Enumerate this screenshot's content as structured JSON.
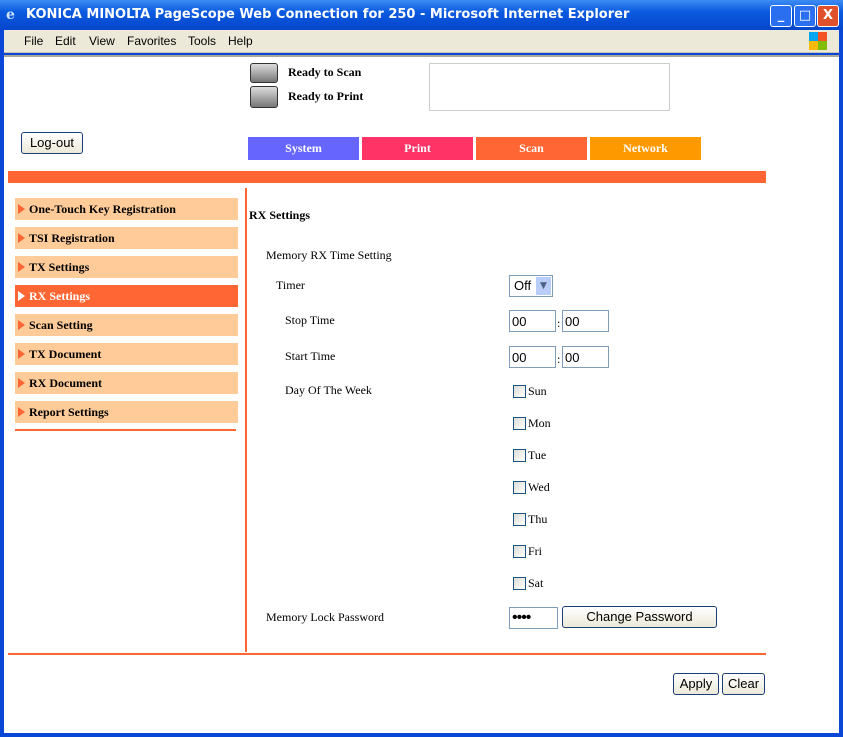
{
  "window": {
    "title": "KONICA MINOLTA PageScope Web Connection for 250 - Microsoft Internet Explorer",
    "minimize": "_",
    "maximize": "□",
    "close": "X"
  },
  "menu": [
    "File",
    "Edit",
    "View",
    "Favorites",
    "Tools",
    "Help"
  ],
  "status": {
    "scan": "Ready to Scan",
    "print": "Ready to Print"
  },
  "logout": "Log-out",
  "tabs": [
    {
      "label": "System",
      "color": "#6666ff"
    },
    {
      "label": "Print",
      "color": "#ff3366"
    },
    {
      "label": "Scan",
      "color": "#ff6633"
    },
    {
      "label": "Network",
      "color": "#ff9900"
    }
  ],
  "accent": "#ff6633",
  "sidebar": [
    "One-Touch Key Registration",
    "TSI Registration",
    "TX Settings",
    "RX Settings",
    "Scan Setting",
    "TX Document",
    "RX Document",
    "Report Settings"
  ],
  "sidebar_active": "RX Settings",
  "main": {
    "title": "RX Settings",
    "section": "Memory RX Time Setting",
    "timer_label": "Timer",
    "timer_value": "Off",
    "stop_label": "Stop Time",
    "stop_h": "00",
    "stop_m": "00",
    "start_label": "Start Time",
    "start_h": "00",
    "start_m": "00",
    "colon": ":",
    "dow_label": "Day Of The Week",
    "days": [
      "Sun",
      "Mon",
      "Tue",
      "Wed",
      "Thu",
      "Fri",
      "Sat"
    ],
    "pw_label": "Memory Lock Password",
    "pw_value": "0000",
    "change_pw": "Change Password"
  },
  "apply": "Apply",
  "clear": "Clear"
}
